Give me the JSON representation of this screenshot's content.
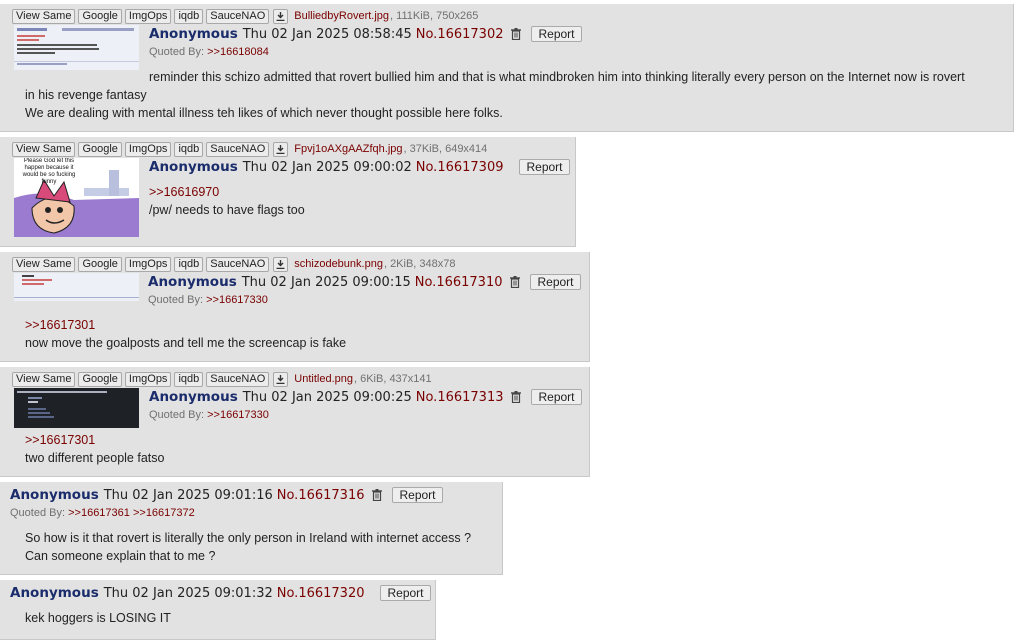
{
  "buttons": {
    "view_same": "View Same",
    "google": "Google",
    "imgops": "ImgOps",
    "iqdb": "iqdb",
    "saucenao": "SauceNAO",
    "report": "Report"
  },
  "quoted_by_label": "Quoted By:",
  "colors": {
    "post_bg": "#e2e2e2",
    "name": "#1a2c6b",
    "link": "#7a0000",
    "meta": "#707070"
  },
  "posts": [
    {
      "file": {
        "name": "BulliedbyRovert.jpg",
        "info": ", 111KiB, 750x265"
      },
      "name": "Anonymous",
      "datetime": "Thu 02 Jan 2025 08:58:45",
      "no": "No.16617302",
      "quoted_by": [
        ">>16618084"
      ],
      "body": [
        "reminder this schizo admitted that rovert bullied him and that is what mindbroken him into thinking literally every person on the Internet now is rovert",
        "in his revenge fantasy",
        "We are dealing with mental illness teh likes of which never thought possible here folks."
      ]
    },
    {
      "file": {
        "name": "Fpvj1oAXgAAZfqh.jpg",
        "info": ", 37KiB, 649x414"
      },
      "thumb_caption": "Please God let this happen because it would be so fucking funny",
      "name": "Anonymous",
      "datetime": "Thu 02 Jan 2025 09:00:02",
      "no": "No.16617309",
      "quote": ">>16616970",
      "body": [
        "/pw/ needs to have flags too"
      ]
    },
    {
      "file": {
        "name": "schizodebunk.png",
        "info": ", 2KiB, 348x78"
      },
      "name": "Anonymous",
      "datetime": "Thu 02 Jan 2025 09:00:15",
      "no": "No.16617310",
      "quoted_by": [
        ">>16617330"
      ],
      "quote": ">>16617301",
      "body": [
        "now move the goalposts and tell me the screencap is fake"
      ]
    },
    {
      "file": {
        "name": "Untitled.png",
        "info": ", 6KiB, 437x141"
      },
      "name": "Anonymous",
      "datetime": "Thu 02 Jan 2025 09:00:25",
      "no": "No.16617313",
      "quoted_by": [
        ">>16617330"
      ],
      "quote": ">>16617301",
      "body": [
        "two different people fatso"
      ]
    },
    {
      "name": "Anonymous",
      "datetime": "Thu 02 Jan 2025 09:01:16",
      "no": "No.16617316",
      "quoted_by": [
        ">>16617361",
        ">>16617372"
      ],
      "body": [
        "So how is it that rovert is literally the only person in Ireland with internet access ?",
        "Can someone explain that to me ?"
      ]
    },
    {
      "name": "Anonymous",
      "datetime": "Thu 02 Jan 2025 09:01:32",
      "no": "No.16617320",
      "body": [
        "kek hoggers is LOSING IT"
      ]
    }
  ]
}
